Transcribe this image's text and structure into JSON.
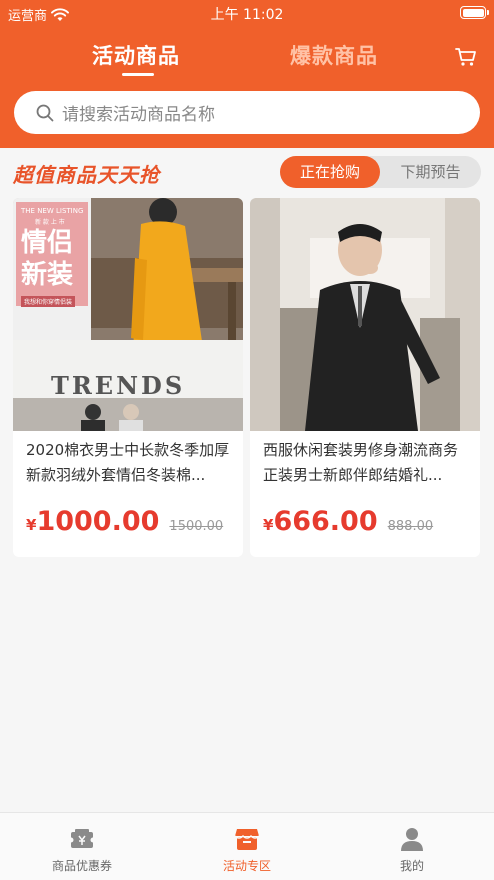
{
  "status_bar": {
    "carrier": "运营商",
    "time": "上午 11:02"
  },
  "header": {
    "tabs": [
      {
        "label": "活动商品",
        "active": true
      },
      {
        "label": "爆款商品",
        "active": false
      }
    ]
  },
  "search": {
    "placeholder": "请搜索活动商品名称"
  },
  "section": {
    "title": "超值商品天天抢",
    "toggle": {
      "on_label": "正在抢购",
      "off_label": "下期预告"
    }
  },
  "products": [
    {
      "name": "2020棉衣男士中长款冬季加厚新款羽绒外套情侣冬装棉...",
      "price_symbol": "¥",
      "price": "1000.00",
      "original_price": "1500.00",
      "image_text": {
        "small": "THE NEW LISTING",
        "small2": "新 款 上 市",
        "big1": "情侣",
        "big2": "新装",
        "tag": "我想和你穿情侣装",
        "trends": "TRENDS"
      }
    },
    {
      "name": "西服休闲套装男修身潮流商务正装男士新郎伴郎结婚礼...",
      "price_symbol": "¥",
      "price": "666.00",
      "original_price": "888.00"
    }
  ],
  "bottom_nav": [
    {
      "label": "商品优惠券",
      "icon": "coupon-icon",
      "active": false
    },
    {
      "label": "活动专区",
      "icon": "store-icon",
      "active": true
    },
    {
      "label": "我的",
      "icon": "user-icon",
      "active": false
    }
  ],
  "colors": {
    "brand": "#f0602b",
    "price": "#e63b2e"
  }
}
